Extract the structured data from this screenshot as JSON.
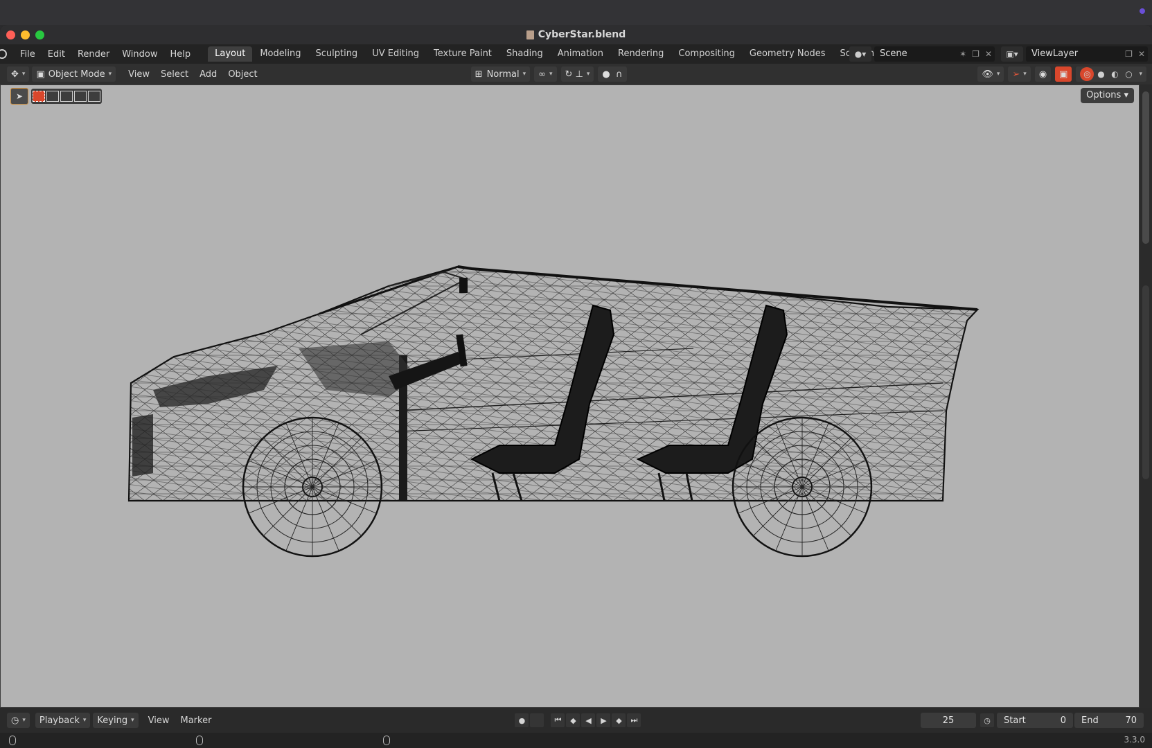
{
  "window": {
    "title": "CyberStar.blend"
  },
  "menu": [
    "File",
    "Edit",
    "Render",
    "Window",
    "Help"
  ],
  "workspaces": [
    "Layout",
    "Modeling",
    "Sculpting",
    "UV Editing",
    "Texture Paint",
    "Shading",
    "Animation",
    "Rendering",
    "Compositing",
    "Geometry Nodes",
    "Scripting"
  ],
  "active_workspace": "Layout",
  "scene": {
    "name": "Scene",
    "view_layer": "ViewLayer"
  },
  "viewport_header": {
    "mode": "Object Mode",
    "menus": [
      "View",
      "Select",
      "Add",
      "Object"
    ],
    "orientation": "Normal",
    "options_label": "Options"
  },
  "viewport": {
    "background": "#b3b3b3",
    "shading": "wireframe"
  },
  "timeline": {
    "menus": {
      "playback": "Playback",
      "keying": "Keying",
      "view": "View",
      "marker": "Marker"
    },
    "current_frame": "25",
    "start_label": "Start",
    "start": "0",
    "end_label": "End",
    "end": "70"
  },
  "status": {
    "version": "3.3.0"
  },
  "colors": {
    "active_tab": "#3f3f3f",
    "accent": "#d9472c",
    "viewport_bg": "#b3b3b3"
  }
}
